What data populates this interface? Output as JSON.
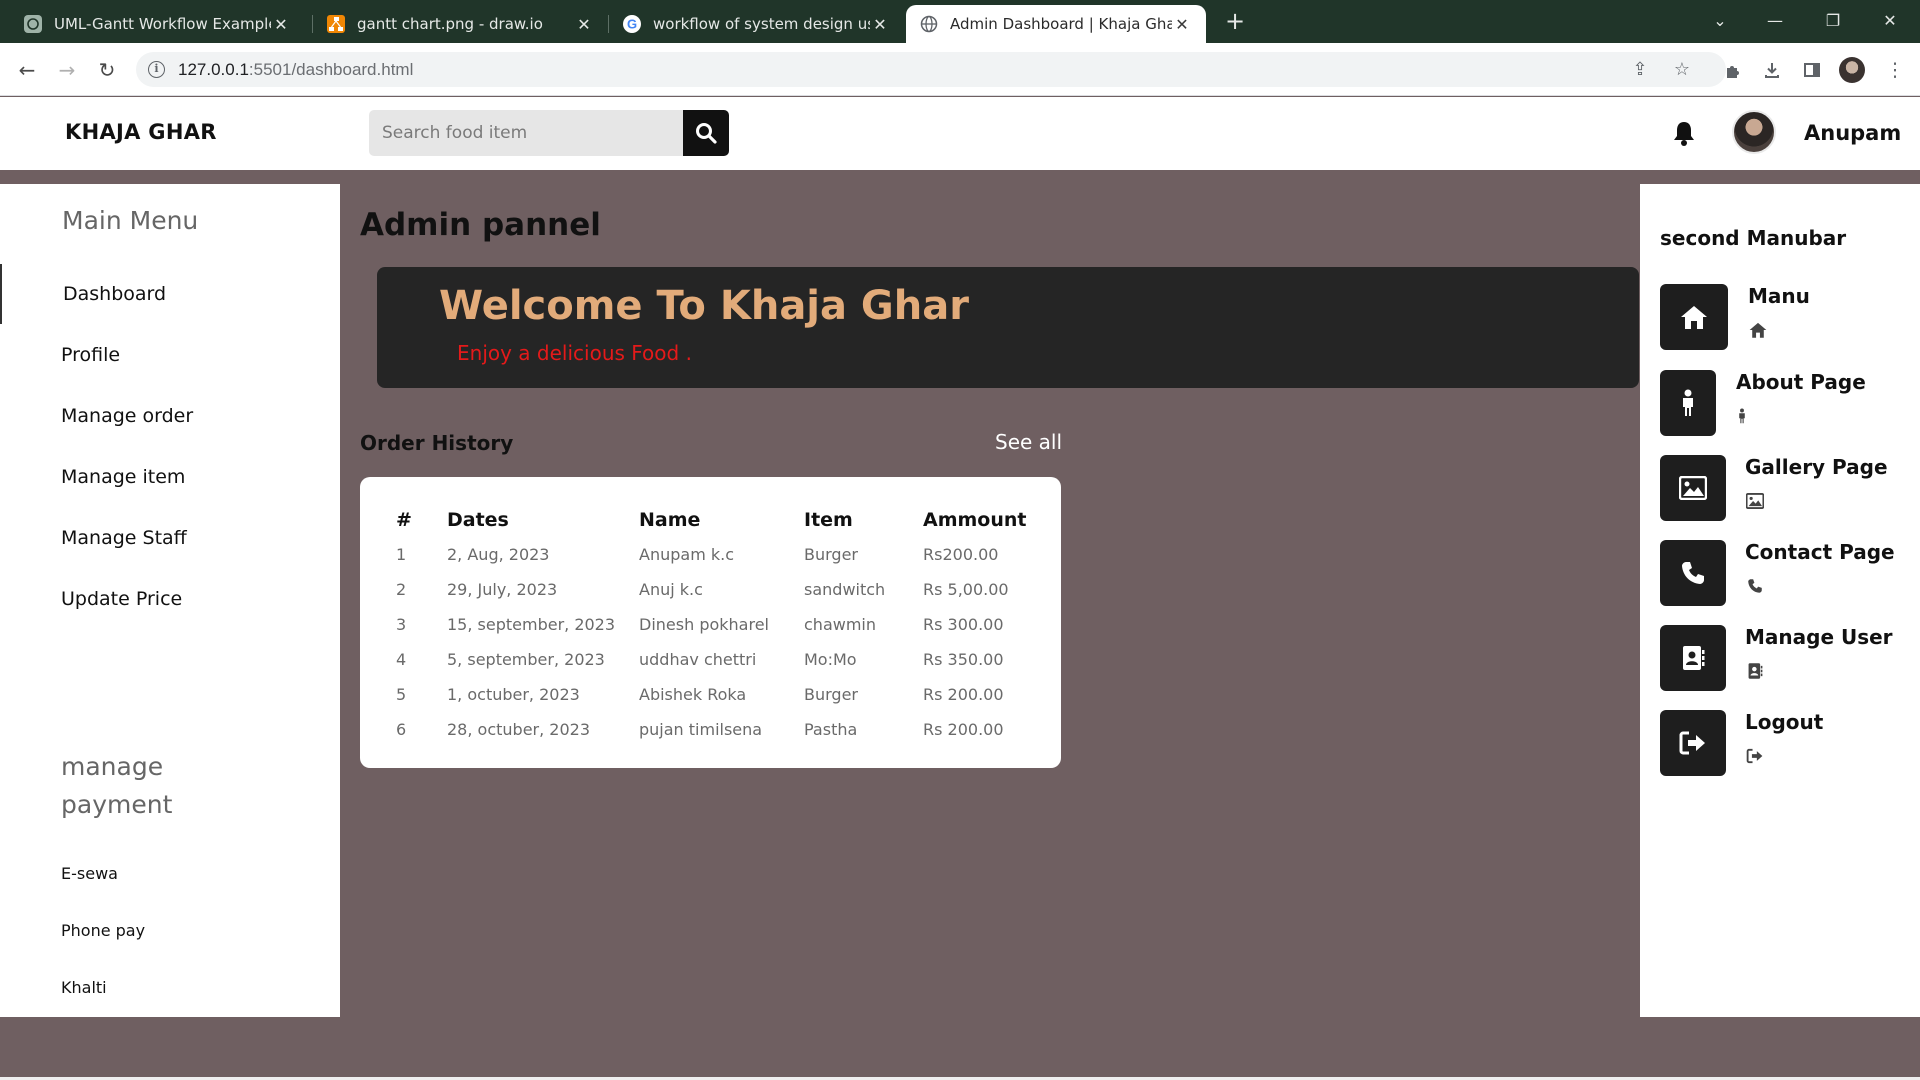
{
  "browser": {
    "tabs": [
      {
        "title": "UML-Gantt Workflow Example",
        "icon": "openai-icon",
        "active": false
      },
      {
        "title": "gantt chart.png - draw.io",
        "icon": "drawio-icon",
        "active": false
      },
      {
        "title": "workflow of system design using",
        "icon": "google-icon",
        "active": false
      },
      {
        "title": "Admin Dashboard | Khaja Ghar",
        "icon": "globe-icon",
        "active": true
      }
    ],
    "new_tab_glyph": "+",
    "url_host": "127.0.0.1",
    "url_rest": ":5501/dashboard.html"
  },
  "header": {
    "brand": "KHAJA GHAR",
    "search_placeholder": "Search food item",
    "username": "Anupam"
  },
  "sidebar": {
    "title": "Main Menu",
    "items": [
      "Dashboard",
      "Profile",
      "Manage order",
      "Manage item",
      "Manage Staff",
      "Update Price"
    ],
    "payment_title": "manage payment",
    "payment_items": [
      "E-sewa",
      "Phone pay",
      "Khalti"
    ]
  },
  "main": {
    "title": "Admin pannel",
    "hero_title": "Welcome To Khaja Ghar",
    "hero_subtitle": "Enjoy a delicious Food .",
    "order_history_title": "Order History",
    "see_all": "See all",
    "table_headers": [
      "#",
      "Dates",
      "Name",
      "Item",
      "Ammount"
    ],
    "rows": [
      [
        "1",
        "2, Aug, 2023",
        "Anupam k.c",
        "Burger",
        "Rs200.00"
      ],
      [
        "2",
        "29, July, 2023",
        "Anuj k.c",
        "sandwitch",
        "Rs 5,00.00"
      ],
      [
        "3",
        "15, september, 2023",
        "Dinesh pokharel",
        "chawmin",
        "Rs 300.00"
      ],
      [
        "4",
        "5, september, 2023",
        "uddhav chettri",
        "Mo:Mo",
        "Rs 350.00"
      ],
      [
        "5",
        "1, octuber, 2023",
        "Abishek Roka",
        "Burger",
        "Rs 200.00"
      ],
      [
        "6",
        "28, octuber, 2023",
        "pujan timilsena",
        "Pastha",
        "Rs 200.00"
      ]
    ]
  },
  "right_sidebar": {
    "title": "second Manubar",
    "items": [
      {
        "label": "Manu",
        "icon": "home-icon"
      },
      {
        "label": "About Page",
        "icon": "person-icon"
      },
      {
        "label": "Gallery Page",
        "icon": "image-icon"
      },
      {
        "label": "Contact Page",
        "icon": "phone-icon"
      },
      {
        "label": "Manage User",
        "icon": "address-book-icon"
      },
      {
        "label": "Logout",
        "icon": "logout-icon"
      }
    ]
  },
  "colors": {
    "page_bg": "#6f5f61",
    "hero_bg": "#252525",
    "hero_title": "#e2ab7a",
    "hero_subtitle": "#e41a1a",
    "tabbar_bg": "#203529"
  }
}
